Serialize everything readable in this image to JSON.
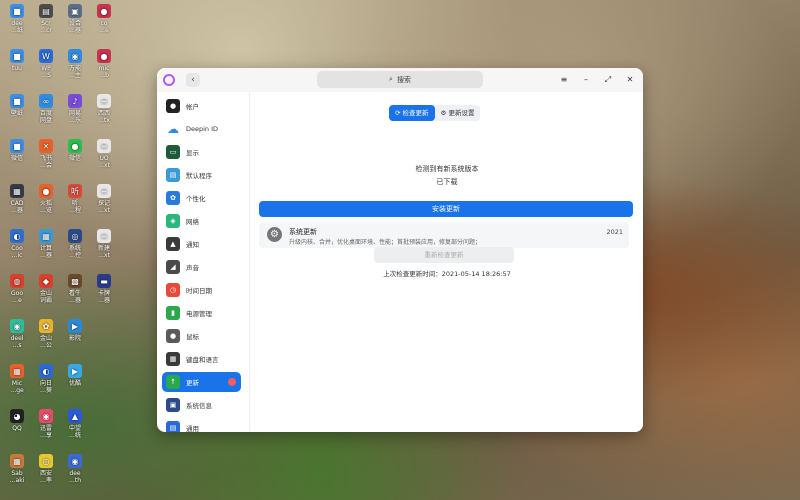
{
  "desktop": {
    "icons": [
      {
        "label": "dee\n…纸",
        "col": 0,
        "row": 0,
        "color": "#3d8ee8",
        "glyph": "■"
      },
      {
        "label": "Scr\n…cr",
        "col": 1,
        "row": 0,
        "color": "#4c4c4c",
        "glyph": "▤"
      },
      {
        "label": "设合\n…器",
        "col": 2,
        "row": 0,
        "color": "#5a6f8a",
        "glyph": "▣"
      },
      {
        "label": "co\n…e",
        "col": 3,
        "row": 0,
        "color": "#c9324d",
        "glyph": "●"
      },
      {
        "label": "tuu",
        "col": 0,
        "row": 1,
        "color": "#3d8ee8",
        "glyph": "■"
      },
      {
        "label": "WP\n…S",
        "col": 1,
        "row": 1,
        "color": "#2d6bd8",
        "glyph": "W"
      },
      {
        "label": "万能\n…主",
        "col": 2,
        "row": 1,
        "color": "#2f8be0",
        "glyph": "◉"
      },
      {
        "label": "mic\n…b",
        "col": 3,
        "row": 1,
        "color": "#c9324d",
        "glyph": "●"
      },
      {
        "label": "壁纸",
        "col": 0,
        "row": 2,
        "color": "#3d8ee8",
        "glyph": "■"
      },
      {
        "label": "百度\n网盘",
        "col": 1,
        "row": 2,
        "color": "#2f8be0",
        "glyph": "∞"
      },
      {
        "label": "网易\n…乐",
        "col": 2,
        "row": 2,
        "color": "#7a4ad8",
        "glyph": "♪"
      },
      {
        "label": "西西\n…tx",
        "col": 3,
        "row": 2,
        "color": "#e7e7e7",
        "glyph": "≡"
      },
      {
        "label": "微信",
        "col": 0,
        "row": 3,
        "color": "#3d8ee8",
        "glyph": "■"
      },
      {
        "label": "飞书\n…会",
        "col": 1,
        "row": 3,
        "color": "#e8602c",
        "glyph": "✕"
      },
      {
        "label": "微信",
        "col": 2,
        "row": 3,
        "color": "#2dbd4e",
        "glyph": "●"
      },
      {
        "label": "UO\n…xt",
        "col": 3,
        "row": 3,
        "color": "#e7e7e7",
        "glyph": "≡"
      },
      {
        "label": "CAD\n…器",
        "col": 0,
        "row": 4,
        "color": "#333a4a",
        "glyph": "▦"
      },
      {
        "label": "火狐\n…览",
        "col": 1,
        "row": 4,
        "color": "#e8602c",
        "glyph": "●"
      },
      {
        "label": "听\n…程",
        "col": 2,
        "row": 4,
        "color": "#d84a3a",
        "glyph": "听"
      },
      {
        "label": "探记\n…xt",
        "col": 3,
        "row": 4,
        "color": "#e7e7e7",
        "glyph": "≡"
      },
      {
        "label": "Coo\n…ic",
        "col": 0,
        "row": 5,
        "color": "#2f6fd0",
        "glyph": "◐"
      },
      {
        "label": "计算\n…器",
        "col": 1,
        "row": 5,
        "color": "#3a9ad8",
        "glyph": "▦"
      },
      {
        "label": "系统\n…控",
        "col": 2,
        "row": 5,
        "color": "#2a4a8a",
        "glyph": "◎"
      },
      {
        "label": "新建\n…xt",
        "col": 3,
        "row": 5,
        "color": "#e7e7e7",
        "glyph": "≡"
      },
      {
        "label": "Goo\n…e",
        "col": 0,
        "row": 6,
        "color": "#d8402c",
        "glyph": "◍"
      },
      {
        "label": "金山\n词霸",
        "col": 1,
        "row": 6,
        "color": "#d8402c",
        "glyph": "◆"
      },
      {
        "label": "看牛\n…器",
        "col": 2,
        "row": 6,
        "color": "#6a4a2a",
        "glyph": "▩"
      },
      {
        "label": "卡牌\n…器",
        "col": 3,
        "row": 6,
        "color": "#2a3a8a",
        "glyph": "▬"
      },
      {
        "label": "deel\n…s",
        "col": 0,
        "row": 7,
        "color": "#2dbd9e",
        "glyph": "◉"
      },
      {
        "label": "金山\n…公",
        "col": 1,
        "row": 7,
        "color": "#e8b42c",
        "glyph": "✿"
      },
      {
        "label": "影院",
        "col": 2,
        "row": 7,
        "color": "#2a8ad8",
        "glyph": "▶"
      },
      {
        "label": "Mic\n…ge",
        "col": 0,
        "row": 8,
        "color": "#e8602c",
        "glyph": "▦"
      },
      {
        "label": "向日\n…葵",
        "col": 1,
        "row": 8,
        "color": "#2a6ad8",
        "glyph": "◐"
      },
      {
        "label": "优酷",
        "col": 2,
        "row": 8,
        "color": "#3aa8e8",
        "glyph": "▶"
      },
      {
        "label": "QQ",
        "col": 0,
        "row": 9,
        "color": "#222222",
        "glyph": "◕"
      },
      {
        "label": "迅雷\n…享",
        "col": 1,
        "row": 9,
        "color": "#e84a6a",
        "glyph": "◉"
      },
      {
        "label": "中望\n…统",
        "col": 2,
        "row": 9,
        "color": "#2a5ad8",
        "glyph": "▲"
      },
      {
        "label": "Sab\n…aki",
        "col": 0,
        "row": 10,
        "color": "#c87a3a",
        "glyph": "▦"
      },
      {
        "label": "西安\n…率",
        "col": 1,
        "row": 10,
        "color": "#e8c82c",
        "glyph": "◎"
      },
      {
        "label": "dee\n…th",
        "col": 2,
        "row": 10,
        "color": "#3a6ad8",
        "glyph": "◉"
      }
    ]
  },
  "window": {
    "search_placeholder": "搜索",
    "search_icon": "search-icon",
    "back_glyph": "‹",
    "menu_glyph": "≡",
    "minimize_glyph": "–",
    "maximize_glyph": "⤢",
    "close_glyph": "✕",
    "accent_color": "#1a73e8"
  },
  "sidebar": {
    "items": [
      {
        "label": "帐户",
        "icon": "account-icon",
        "color": "#222222",
        "glyph": "●"
      },
      {
        "label": "Deepin ID",
        "icon": "cloud-icon",
        "color": "#2f8be0",
        "glyph": "☁"
      },
      {
        "label": "显示",
        "icon": "display-icon",
        "color": "#1f5a3a",
        "glyph": "▭"
      },
      {
        "label": "默认程序",
        "icon": "default-apps-icon",
        "color": "#3a9ad8",
        "glyph": "▤"
      },
      {
        "label": "个性化",
        "icon": "personalization-icon",
        "color": "#2a7ad8",
        "glyph": "✿"
      },
      {
        "label": "网络",
        "icon": "network-icon",
        "color": "#2ab87a",
        "glyph": "◈"
      },
      {
        "label": "通知",
        "icon": "notification-icon",
        "color": "#3a3a3a",
        "glyph": "▲"
      },
      {
        "label": "声音",
        "icon": "sound-icon",
        "color": "#4a4a4a",
        "glyph": "◢"
      },
      {
        "label": "时间日期",
        "icon": "clock-icon",
        "color": "#e84a3a",
        "glyph": "◷"
      },
      {
        "label": "电源管理",
        "icon": "power-icon",
        "color": "#2aa84a",
        "glyph": "▮"
      },
      {
        "label": "鼠标",
        "icon": "mouse-icon",
        "color": "#5a5a5a",
        "glyph": "●"
      },
      {
        "label": "键盘和语言",
        "icon": "keyboard-icon",
        "color": "#3a3a3a",
        "glyph": "▦"
      },
      {
        "label": "更新",
        "icon": "update-icon",
        "color": "#2aa84a",
        "glyph": "↑",
        "active": true
      },
      {
        "label": "系统信息",
        "icon": "system-info-icon",
        "color": "#2a4a8a",
        "glyph": "▣"
      },
      {
        "label": "通用",
        "icon": "general-icon",
        "color": "#2a6ad8",
        "glyph": "▤"
      }
    ]
  },
  "main": {
    "tabs": [
      {
        "label": "检查更新",
        "icon": "refresh-icon",
        "glyph": "⟳",
        "active": true
      },
      {
        "label": "更新设置",
        "icon": "gear-icon",
        "glyph": "⚙",
        "active": false
      }
    ],
    "status_line1": "检测到有新系统版本",
    "status_line2": "已下载",
    "install_label": "安装更新",
    "update_item": {
      "title": "系统更新",
      "description": "升级内核、合并，优化桌面环境、性能；首批预装应用，修复部分问题；",
      "version": "2021",
      "icon": "gear-icon"
    },
    "recheck_label": "重新检查更新",
    "last_check": "上次检查更新时间：2021-05-14 18:26:57"
  }
}
